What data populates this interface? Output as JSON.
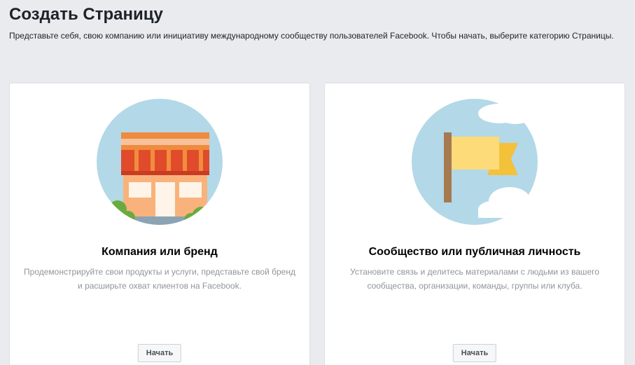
{
  "header": {
    "title": "Создать Страницу",
    "description": "Представьте себя, свою компанию или инициативу международному сообществу пользователей Facebook. Чтобы начать, выберите категорию Страницы."
  },
  "cards": [
    {
      "title": "Компания или бренд",
      "description": "Продемонстрируйте свои продукты и услуги, представьте свой бренд и расширьте охват клиентов на Facebook.",
      "button_label": "Начать",
      "icon": "storefront-icon"
    },
    {
      "title": "Сообщество или публичная личность",
      "description": "Установите связь и делитесь материалами с людьми из вашего сообщества, организации, команды, группы или клуба.",
      "button_label": "Начать",
      "icon": "flag-icon"
    }
  ],
  "colors": {
    "background": "#e9ebee",
    "card_bg": "#ffffff",
    "sky": "#b3d8e8",
    "awning_red": "#e04b2b",
    "awning_orange": "#ef8b3d",
    "storefront": "#f9b27b",
    "bush": "#6aab3f",
    "flag_yellow": "#fddb79",
    "flag_tail": "#f4c13b",
    "pole": "#a57a51",
    "muted_text": "#90949c"
  }
}
